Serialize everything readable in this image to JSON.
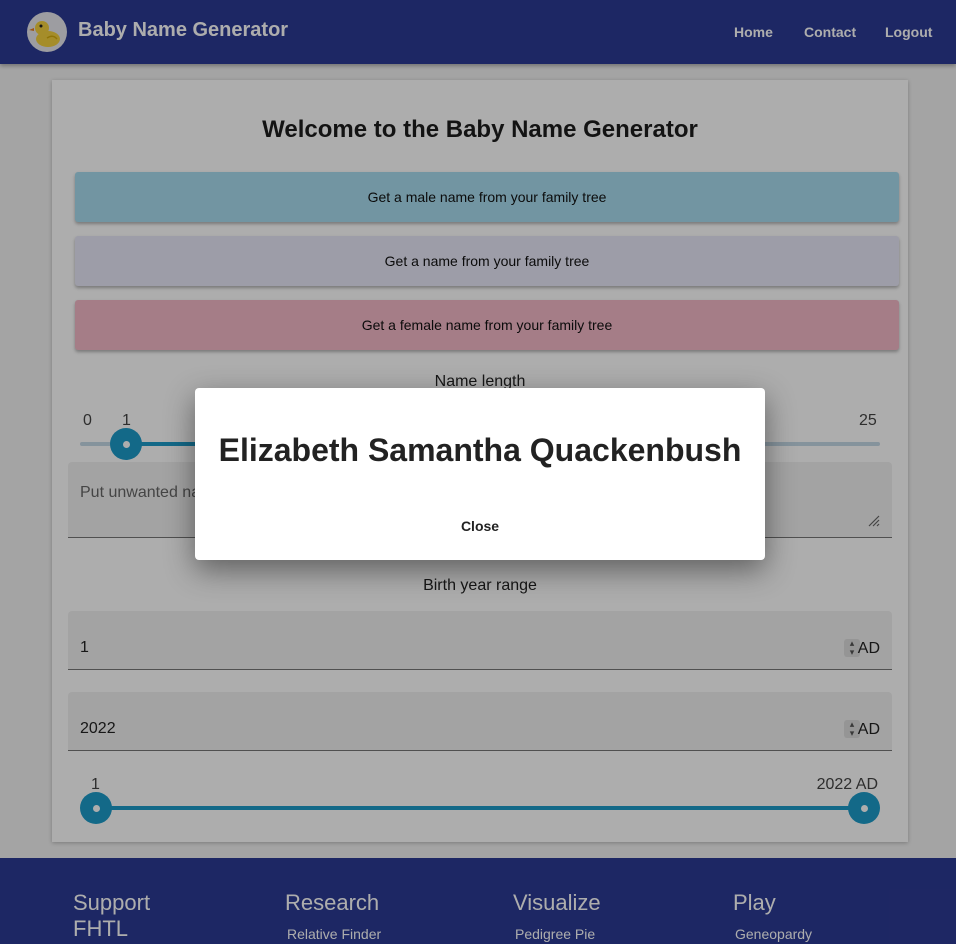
{
  "header": {
    "brand": "Baby Name Generator",
    "logo_icon": "duck-icon",
    "nav": {
      "home": "Home",
      "contact": "Contact",
      "logout": "Logout"
    }
  },
  "main": {
    "title": "Welcome to the Baby Name Generator",
    "buttons": {
      "male": "Get a male name from your family tree",
      "any": "Get a name from your family tree",
      "female": "Get a female name from your family tree"
    },
    "name_length": {
      "label": "Name length",
      "min_label": "0",
      "max_label": "25",
      "value_label": "1",
      "value": 1,
      "min": 0,
      "max": 25
    },
    "unwanted": {
      "placeholder": "Put unwanted na"
    },
    "birth_year": {
      "label": "Birth year range",
      "from_value": "1",
      "to_value": "2022",
      "unit": "AD",
      "slider_min_label": "1",
      "slider_max_label": "2022 AD",
      "range": [
        1,
        2022
      ]
    }
  },
  "dialog": {
    "name": "Elizabeth Samantha Quackenbush",
    "close_label": "Close"
  },
  "footer": {
    "columns": [
      {
        "heading": "Support FHTL",
        "link": ""
      },
      {
        "heading": "Research",
        "link": "Relative Finder"
      },
      {
        "heading": "Visualize",
        "link": "Pedigree Pie"
      },
      {
        "heading": "Play",
        "link": "Geneopardy"
      }
    ]
  },
  "colors": {
    "header": "#2c3a94",
    "accent": "#1d9bc9",
    "male_button": "#a8dcef",
    "any_button": "#e8e8f8",
    "female_button": "#f4b8c8"
  }
}
